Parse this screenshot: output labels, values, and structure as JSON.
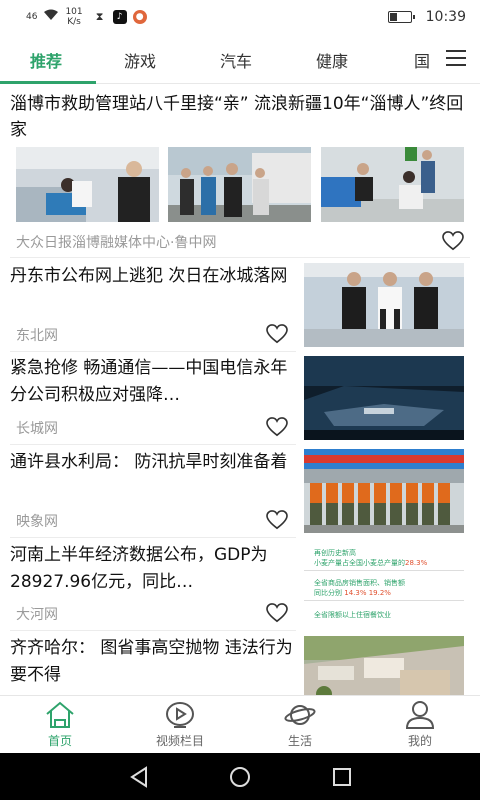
{
  "status_bar": {
    "signal": "46",
    "speed_value": "101",
    "speed_unit": "K/s",
    "time": "10:39",
    "battery_level": 0.35
  },
  "tabs": [
    {
      "label": "推荐",
      "active": true
    },
    {
      "label": "游戏",
      "active": false
    },
    {
      "label": "汽车",
      "active": false
    },
    {
      "label": "健康",
      "active": false
    },
    {
      "label": "国",
      "active": false
    }
  ],
  "feed": {
    "featured": {
      "title": "淄博市救助管理站八千里接“亲” 流浪新疆10年“淄博人”终回家",
      "source": "大众日报淄博融媒体中心·鲁中网"
    },
    "items": [
      {
        "title": "丹东市公布网上逃犯 次日在冰城落网",
        "source": "东北网"
      },
      {
        "title": "紧急抢修 畅通通信——中国电信永年分公司积极应对强降…",
        "source": "长城网"
      },
      {
        "title": "通许县水利局： 防汛抗旱时刻准备着",
        "source": "映象网"
      },
      {
        "title": "河南上半年经济数据公布，GDP为28927.96亿元，同比…",
        "source": "大河网"
      },
      {
        "title": "齐齐哈尔： 图省事高空抛物 违法行为要不得",
        "source": ""
      }
    ],
    "infographic": {
      "line1": "再创历史新高",
      "line2": "小麦产量占全国小麦总产量的",
      "pct1": "28.3%",
      "line3": "全省商品房销售面积、销售额",
      "line4": "同比分别",
      "pct2": "14.3%",
      "pct3": "19.2%",
      "line5": "全省限额以上住宿餐饮业"
    }
  },
  "bottom_nav": [
    {
      "label": "首页",
      "active": true
    },
    {
      "label": "视频栏目",
      "active": false
    },
    {
      "label": "生活",
      "active": false
    },
    {
      "label": "我的",
      "active": false
    }
  ],
  "colors": {
    "accent": "#2ea36b",
    "secondary_text": "#9a9a9a"
  }
}
